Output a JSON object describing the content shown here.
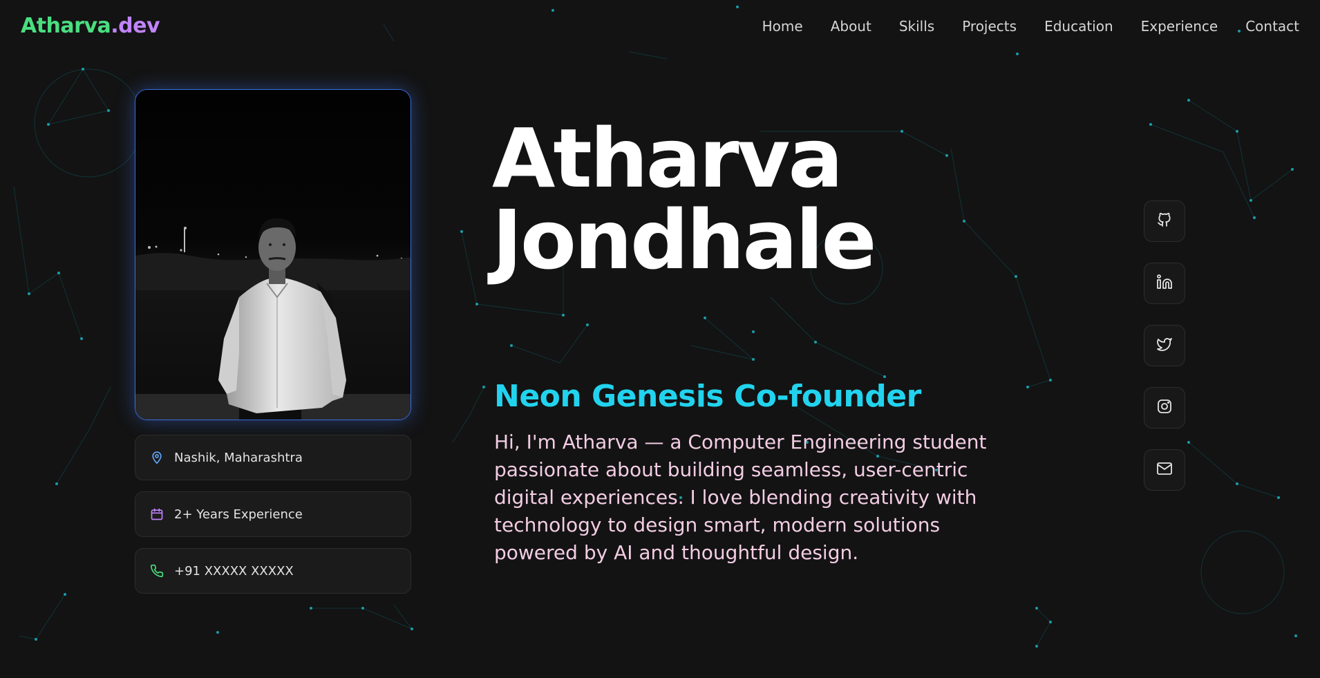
{
  "brand": {
    "name_part1": "Atharva",
    "name_part2": ".dev"
  },
  "nav": {
    "items": [
      {
        "label": "Home"
      },
      {
        "label": "About"
      },
      {
        "label": "Skills"
      },
      {
        "label": "Projects"
      },
      {
        "label": "Education"
      },
      {
        "label": "Experience"
      },
      {
        "label": "Contact"
      }
    ]
  },
  "profile": {
    "location": "Nashik, Maharashtra",
    "experience": "2+ Years Experience",
    "phone": "+91 XXXXX XXXXX"
  },
  "hero": {
    "first_name": "Atharva",
    "last_name": "Jondhale",
    "role": "Neon Genesis Co-founder",
    "bio": "Hi, I'm Atharva — a Computer Engineering student passionate about building seamless, user-centric digital experiences. I love blending creativity with technology to design smart, modern solutions powered by AI and thoughtful design."
  },
  "social": [
    {
      "icon": "github-icon"
    },
    {
      "icon": "linkedin-icon"
    },
    {
      "icon": "twitter-icon"
    },
    {
      "icon": "instagram-icon"
    },
    {
      "icon": "mail-icon"
    }
  ],
  "colors": {
    "background": "#131313",
    "brand_green": "#4ade80",
    "brand_purple": "#c084fc",
    "role_cyan": "#22d3ee",
    "bio_pink": "#f3cde4",
    "photo_border": "#3b6fe0"
  }
}
